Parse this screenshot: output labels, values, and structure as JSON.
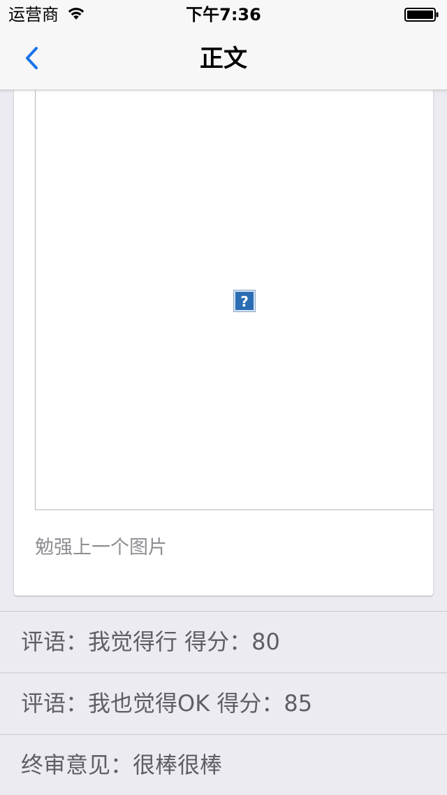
{
  "status_bar": {
    "carrier": "运营商",
    "time": "下午7:36",
    "wifi_icon": "wifi-icon",
    "battery_icon": "battery-full-icon"
  },
  "nav": {
    "title": "正文",
    "back_icon": "chevron-left-icon",
    "accent_color": "#1a73e8"
  },
  "card": {
    "image_placeholder_icon": "broken-image-icon",
    "caption": "勉强上一个图片"
  },
  "comments": [
    {
      "text": "评语：我觉得行 得分：80"
    },
    {
      "text": "评语：我也觉得OK 得分：85"
    },
    {
      "text": "终审意见：很棒很棒"
    }
  ]
}
